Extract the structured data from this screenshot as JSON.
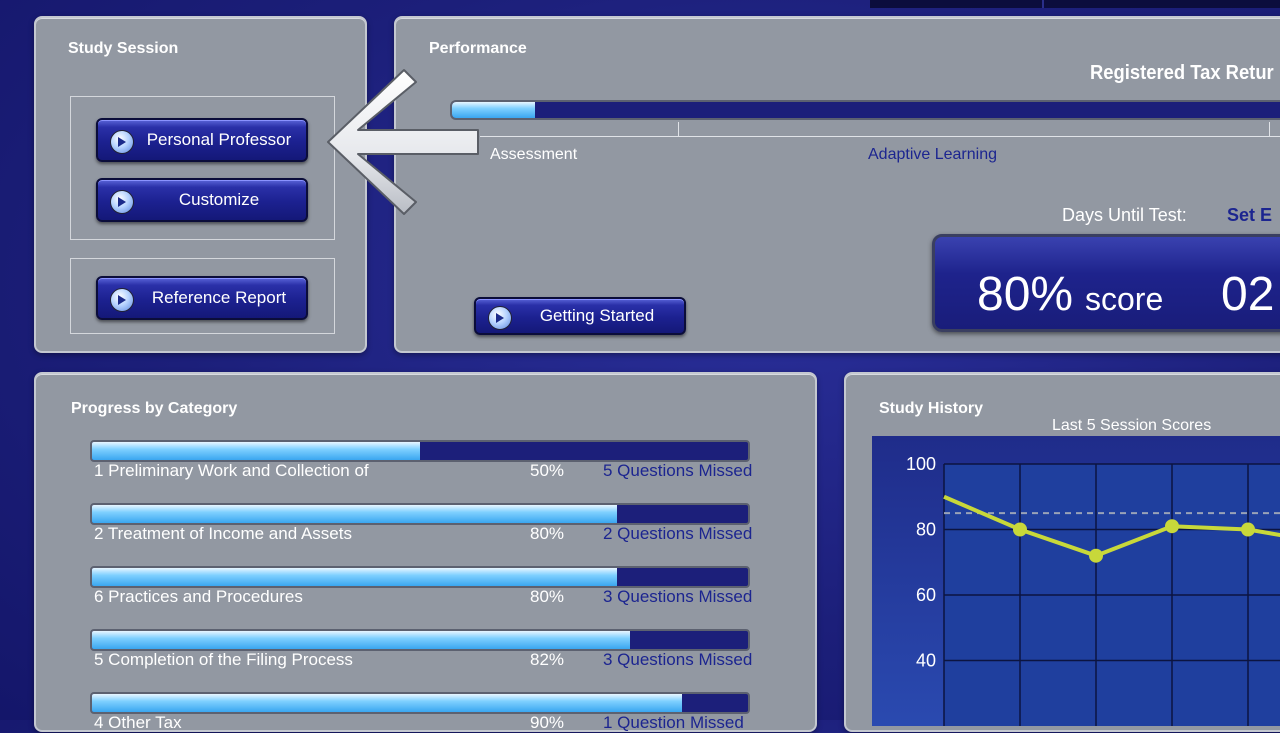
{
  "study_session": {
    "title": "Study Session",
    "buttons": [
      {
        "label": "Personal Professor"
      },
      {
        "label": "Customize"
      },
      {
        "label": "Reference Report"
      }
    ]
  },
  "performance": {
    "title": "Performance",
    "exam_title": "Registered Tax Retur",
    "progress": 0.1,
    "stages": [
      "Assessment",
      "Adaptive Learning"
    ],
    "days_label": "Days Until Test:",
    "days_value": "Set E",
    "score_value": "80%",
    "score_label": "score",
    "second_value": "02",
    "getting_started": "Getting Started"
  },
  "progress_by_category": {
    "title": "Progress by Category",
    "items": [
      {
        "name": "1 Preliminary Work and Collection of",
        "percent": "50%",
        "fill": 0.5,
        "missed": "5 Questions Missed"
      },
      {
        "name": "2 Treatment of Income and Assets",
        "percent": "80%",
        "fill": 0.8,
        "missed": "2 Questions Missed"
      },
      {
        "name": "6 Practices and Procedures",
        "percent": "80%",
        "fill": 0.8,
        "missed": "3 Questions Missed"
      },
      {
        "name": "5 Completion of the Filing Process",
        "percent": "82%",
        "fill": 0.82,
        "missed": "3 Questions Missed"
      },
      {
        "name": "4 Other Tax",
        "percent": "90%",
        "fill": 0.9,
        "missed": "1 Question Missed"
      }
    ]
  },
  "study_history": {
    "title": "Study History"
  },
  "chart_data": {
    "type": "line",
    "title": "Last 5 Session Scores",
    "xlabel": "",
    "ylabel": "",
    "x": [
      1,
      2,
      3,
      4,
      5,
      6
    ],
    "ylim": [
      20,
      100
    ],
    "yticks": [
      40,
      60,
      80,
      100
    ],
    "reference_line": 85,
    "grid": true,
    "line_color": "#c8d83a",
    "series": [
      {
        "values": [
          90,
          80,
          72,
          81,
          80,
          76
        ]
      }
    ]
  }
}
